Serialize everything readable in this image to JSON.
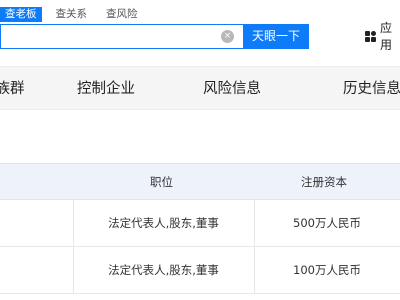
{
  "search_tabs": [
    {
      "label": "查老板",
      "active": true
    },
    {
      "label": "查关系",
      "active": false
    },
    {
      "label": "查风险",
      "active": false
    }
  ],
  "search": {
    "value": "",
    "placeholder": "",
    "clear_glyph": "×",
    "button_label": "天眼一下"
  },
  "app_link": {
    "label": "应用"
  },
  "nav": {
    "items": [
      {
        "label": "家族群"
      },
      {
        "label": "控制企业"
      },
      {
        "label": "风险信息"
      },
      {
        "label": "历史信息"
      }
    ]
  },
  "table": {
    "headers": [
      "职位",
      "注册资本"
    ],
    "rows": [
      {
        "position": "法定代表人,股东,董事",
        "capital": "500万人民币"
      },
      {
        "position": "法定代表人,股东,董事",
        "capital": "100万人民币"
      }
    ]
  },
  "colors": {
    "accent": "#0e7bf8",
    "nav_bg": "#f5f5f5",
    "table_header_bg": "#eef3fb"
  }
}
